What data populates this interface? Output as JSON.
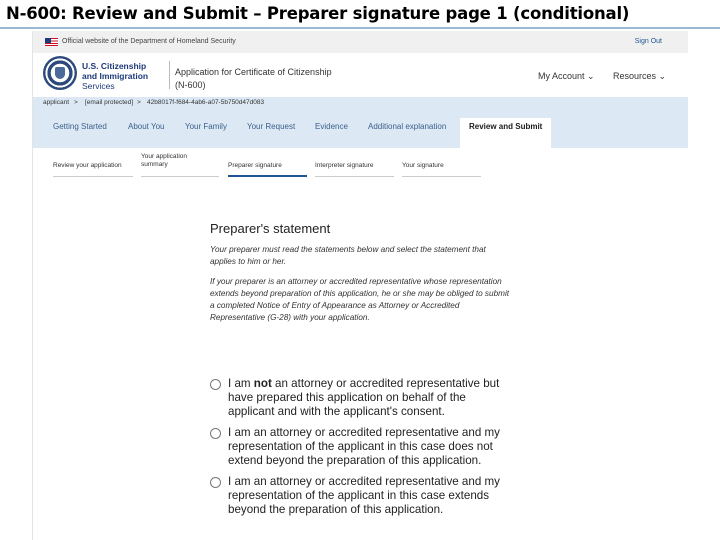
{
  "slide_title": "N-600: Review and Submit – Preparer signature page 1 (conditional)",
  "gov_banner": {
    "text": "Official website of the Department of Homeland Security",
    "sign_out": "Sign Out"
  },
  "header": {
    "agency_line1": "U.S. Citizenship",
    "agency_line2": "and Immigration",
    "agency_line3": "Services",
    "app_title_line1": "Application for Certificate of Citizenship",
    "app_title_line2": "(N-600)",
    "my_account": "My Account ⌄",
    "resources": "Resources ⌄"
  },
  "receipt_bar": {
    "applicant": "applicant",
    "sep1": ">",
    "email": "[email protected]",
    "sep2": ">",
    "receipt": "42b8017f-f684-4ab6-a07-5b750d47d083"
  },
  "nav_tabs": [
    "Getting Started",
    "About You",
    "Your Family",
    "Your Request",
    "Evidence",
    "Additional explanation",
    "Review and Submit"
  ],
  "subtabs": {
    "review": "Review your application",
    "summary_line1": "Your application",
    "summary_line2": "summary",
    "preparer": "Preparer signature",
    "interpreter": "Interpreter signature",
    "yours": "Your signature"
  },
  "main": {
    "heading": "Preparer's statement",
    "para1": "Your preparer must read the statements below and select the statement that applies to him or her.",
    "para2": "If your preparer is an attorney or accredited representative whose representation extends beyond preparation of this application, he or she may be obliged to submit a completed Notice of Entry of Appearance as Attorney or Accredited Representative (G-28) with your application.",
    "option1_pre": "I am ",
    "option1_bold": "not",
    "option1_post": " an attorney or accredited representative but have prepared this application on behalf of the applicant and with the applicant's consent.",
    "option2": "I am an attorney or accredited representative and my representation of the applicant in this case does not extend beyond the preparation of this application.",
    "option3": "I am an attorney or accredited representative and my representation of the applicant in this case extends beyond the preparation of this application."
  }
}
